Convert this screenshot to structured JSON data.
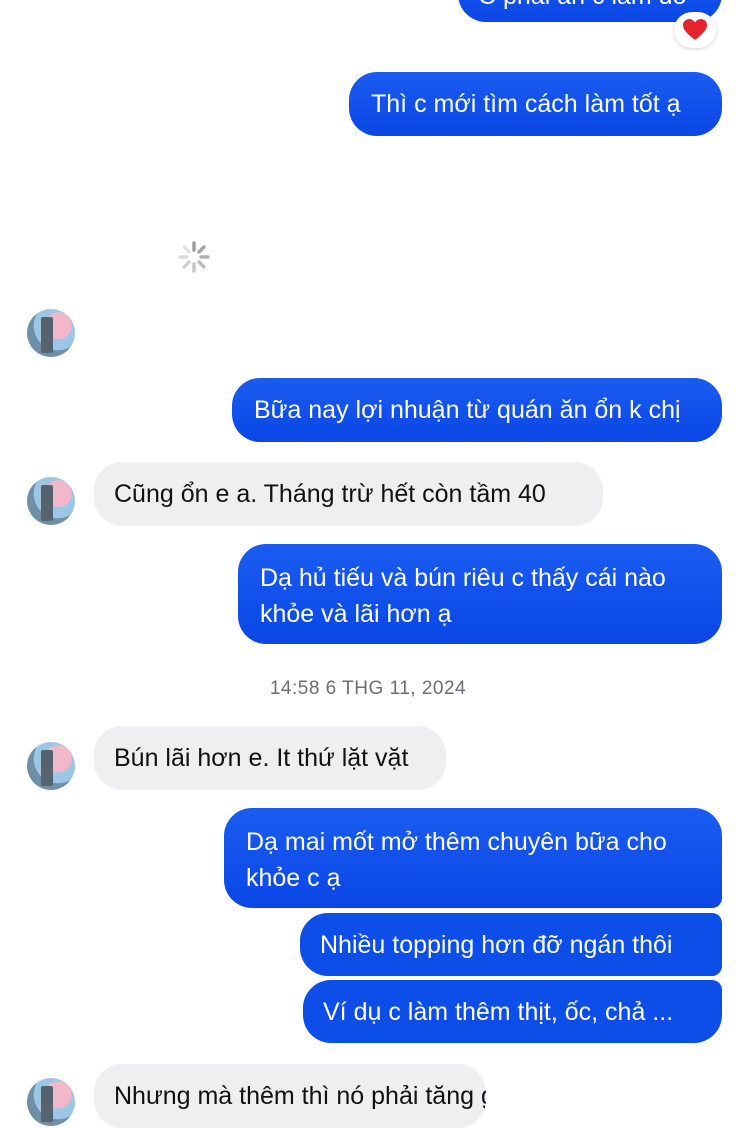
{
  "messages": {
    "m0": "C phải ăn c làm đó",
    "m1": "Thì c mới tìm cách làm tốt ạ",
    "m2": "Bữa nay lợi nhuận từ quán ăn ổn k chị",
    "m3": "Cũng ổn e a. Tháng trừ hết còn tầm 40",
    "m4_line1": "Dạ hủ tiếu và bún riêu c thấy cái nào",
    "m4_line2": "khỏe và lãi hơn ạ",
    "m5": "Bún lãi hơn e. It thứ lặt vặt",
    "m6_line1": "Dạ mai mốt mở thêm chuyên bữa cho",
    "m6_line2": "khỏe c ạ",
    "m7": "Nhiều topping hơn đỡ ngán thôi",
    "m8": "Ví dụ c làm thêm thịt, ốc, chả ...",
    "m9": "Nhưng mà thêm thì nó phải tăng giá"
  },
  "timestamp": "14:58 6 THG 11, 2024",
  "reaction": "heart-icon",
  "loading": "spinner-icon",
  "colors": {
    "outgoing": "#0d4de8",
    "incoming": "#efeff2",
    "timestamp": "#6b6e74",
    "heart": "#e5232d"
  }
}
